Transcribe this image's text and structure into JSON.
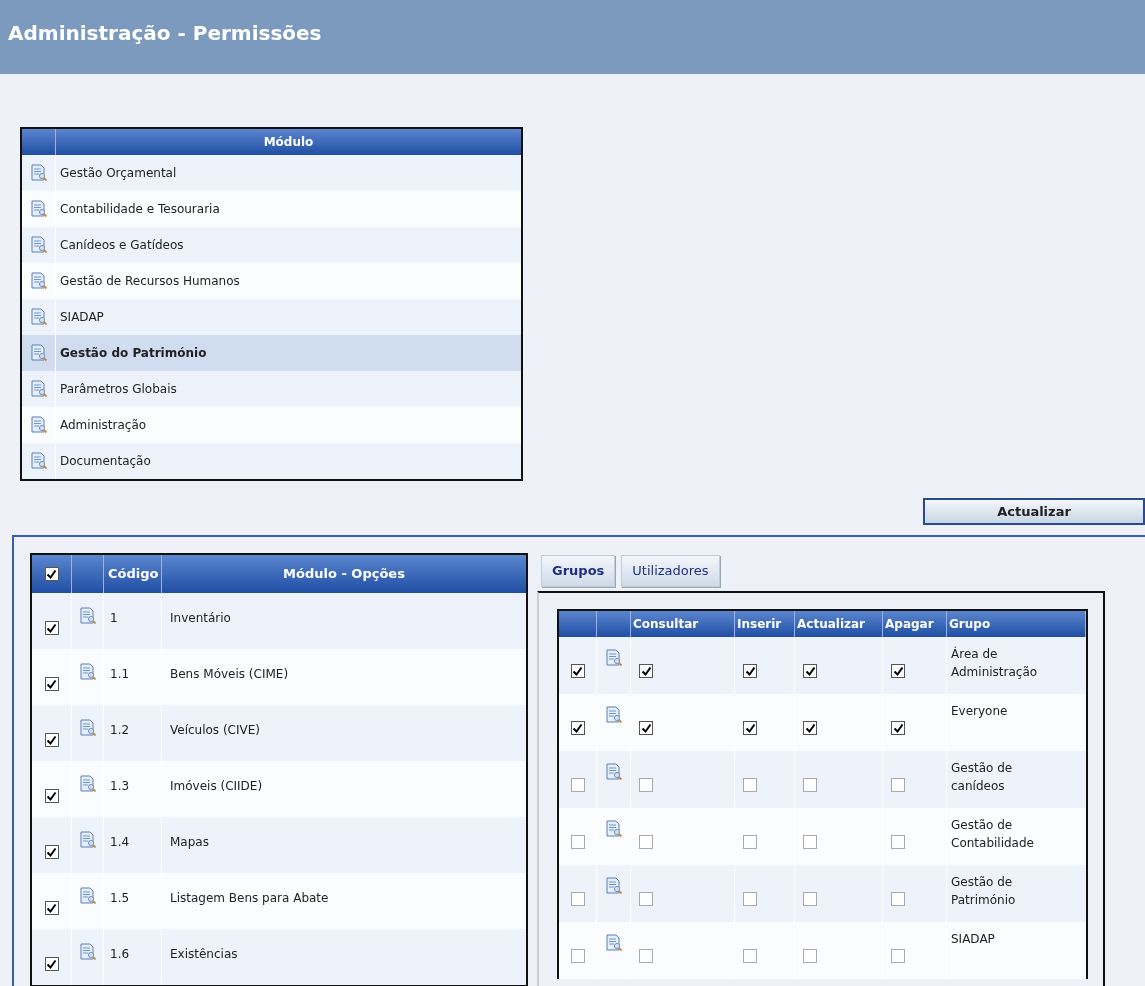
{
  "page": {
    "title": "Administração - Permissões"
  },
  "modules": {
    "header": "Módulo",
    "rows": [
      {
        "name": "Gestão Orçamental",
        "selected": false
      },
      {
        "name": "Contabilidade e Tesouraria",
        "selected": false
      },
      {
        "name": "Canídeos e Gatídeos",
        "selected": false
      },
      {
        "name": "Gestão de Recursos Humanos",
        "selected": false
      },
      {
        "name": "SIADAP",
        "selected": false
      },
      {
        "name": "Gestão do Património",
        "selected": true
      },
      {
        "name": "Parâmetros Globais",
        "selected": false
      },
      {
        "name": "Administração",
        "selected": false
      },
      {
        "name": "Documentação",
        "selected": false
      }
    ]
  },
  "update_button": "Actualizar",
  "options": {
    "all_checked": true,
    "columns": [
      "Código",
      "Módulo - Opções"
    ],
    "rows": [
      {
        "code": "1",
        "name": "Inventário",
        "checked": true
      },
      {
        "code": "1.1",
        "name": "Bens Móveis (CIME)",
        "checked": true
      },
      {
        "code": "1.2",
        "name": "Veículos (CIVE)",
        "checked": true
      },
      {
        "code": "1.3",
        "name": "Imóveis (CIIDE)",
        "checked": true
      },
      {
        "code": "1.4",
        "name": "Mapas",
        "checked": true
      },
      {
        "code": "1.5",
        "name": "Listagem Bens para Abate",
        "checked": true
      },
      {
        "code": "1.6",
        "name": "Existências",
        "checked": true
      }
    ]
  },
  "tabs": [
    {
      "label": "Grupos",
      "selected": true
    },
    {
      "label": "Utilizadores",
      "selected": false
    }
  ],
  "permissions": {
    "columns": [
      "Consultar",
      "Inserir",
      "Actualizar",
      "Apagar",
      "Grupo"
    ],
    "rows": [
      {
        "checked": true,
        "consultar": true,
        "inserir": true,
        "actualizar": true,
        "apagar": true,
        "group": "Área de Administração"
      },
      {
        "checked": true,
        "consultar": true,
        "inserir": true,
        "actualizar": true,
        "apagar": true,
        "group": "Everyone"
      },
      {
        "checked": false,
        "consultar": false,
        "inserir": false,
        "actualizar": false,
        "apagar": false,
        "group": "Gestão de canídeos"
      },
      {
        "checked": false,
        "consultar": false,
        "inserir": false,
        "actualizar": false,
        "apagar": false,
        "group": "Gestão de Contabilidade"
      },
      {
        "checked": false,
        "consultar": false,
        "inserir": false,
        "actualizar": false,
        "apagar": false,
        "group": "Gestão de Património"
      },
      {
        "checked": false,
        "consultar": false,
        "inserir": false,
        "actualizar": false,
        "apagar": false,
        "group": "SIADAP"
      }
    ]
  }
}
